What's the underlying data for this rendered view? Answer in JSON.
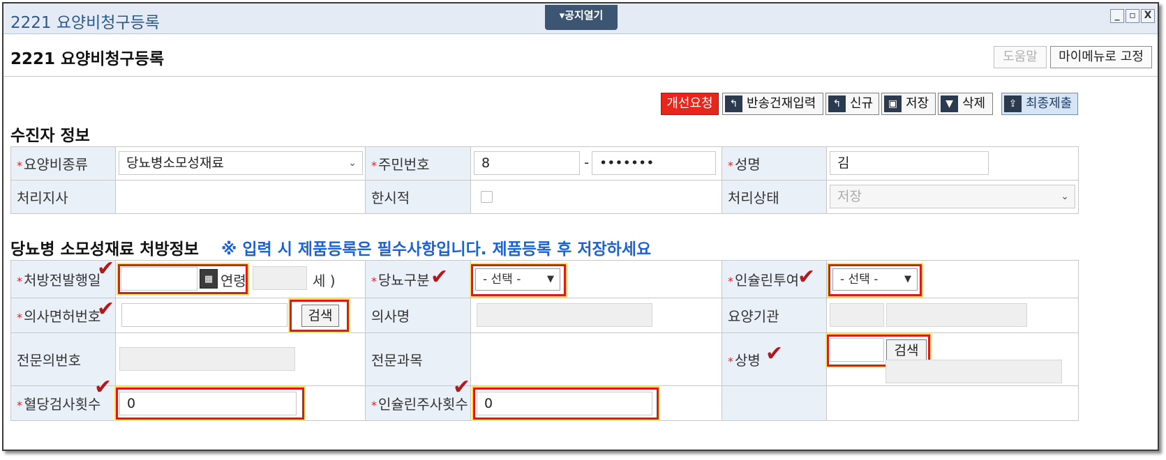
{
  "window": {
    "title": "2221 요양비청구등록",
    "notice_tab": "▾공지열기",
    "controls": {
      "minimize": "_",
      "restore": "▫",
      "close": "X"
    }
  },
  "header": {
    "title": "2221 요양비청구등록",
    "help_label": "도움말",
    "pin_label": "마이메뉴로 고정"
  },
  "toolbar": {
    "improve_label": "개선요청",
    "return_input_label": "반송건재입력",
    "new_label": "신규",
    "save_label": "저장",
    "delete_label": "삭제",
    "final_submit_label": "최종제출"
  },
  "recipient": {
    "section_title": "수진자 정보",
    "care_type_label": "요양비종류",
    "care_type_value": "당뇨병소모성재료",
    "rrn_label": "주민번호",
    "rrn_front": "8",
    "rrn_dash": "-",
    "rrn_back": "•••••••",
    "name_label": "성명",
    "name_value": "김",
    "branch_label": "처리지사",
    "temp_label": "한시적",
    "status_label": "처리상태",
    "status_value": "저장"
  },
  "prescription": {
    "section_title": "당뇨병 소모성재료 처방정보",
    "notice": "※ 입력 시 제품등록은 필수사항입니다. 제품등록 후 저장하세요",
    "issue_date_label": "처방전발행일",
    "age_label": "연령",
    "age_suffix": "세 )",
    "diabetes_type_label": "당뇨구분",
    "diabetes_type_value": "- 선택 -",
    "insulin_label": "인슐린투여",
    "insulin_value": "- 선택 -",
    "license_label": "의사면허번호",
    "search_label": "검색",
    "doctor_name_label": "의사명",
    "institution_label": "요양기관",
    "specialist_no_label": "전문의번호",
    "specialty_label": "전문과목",
    "disease_label": "상병",
    "disease_search_label": "검색",
    "glucose_test_label": "혈당검사횟수",
    "glucose_test_value": "0",
    "insulin_inject_label": "인슐린주사횟수",
    "insulin_inject_value": "0"
  },
  "icons": {
    "back_arrow": "↰",
    "save_disk": "▣",
    "trash": "▼",
    "submit": "⇪",
    "calendar": "▦",
    "check": "✔",
    "required": "*"
  },
  "colors": {
    "accent_blue": "#1a62d6",
    "required_red": "#e02020",
    "highlight_red": "#e01818",
    "highlight_yellow": "#ffe55a",
    "label_bg": "#eaf0f8"
  }
}
